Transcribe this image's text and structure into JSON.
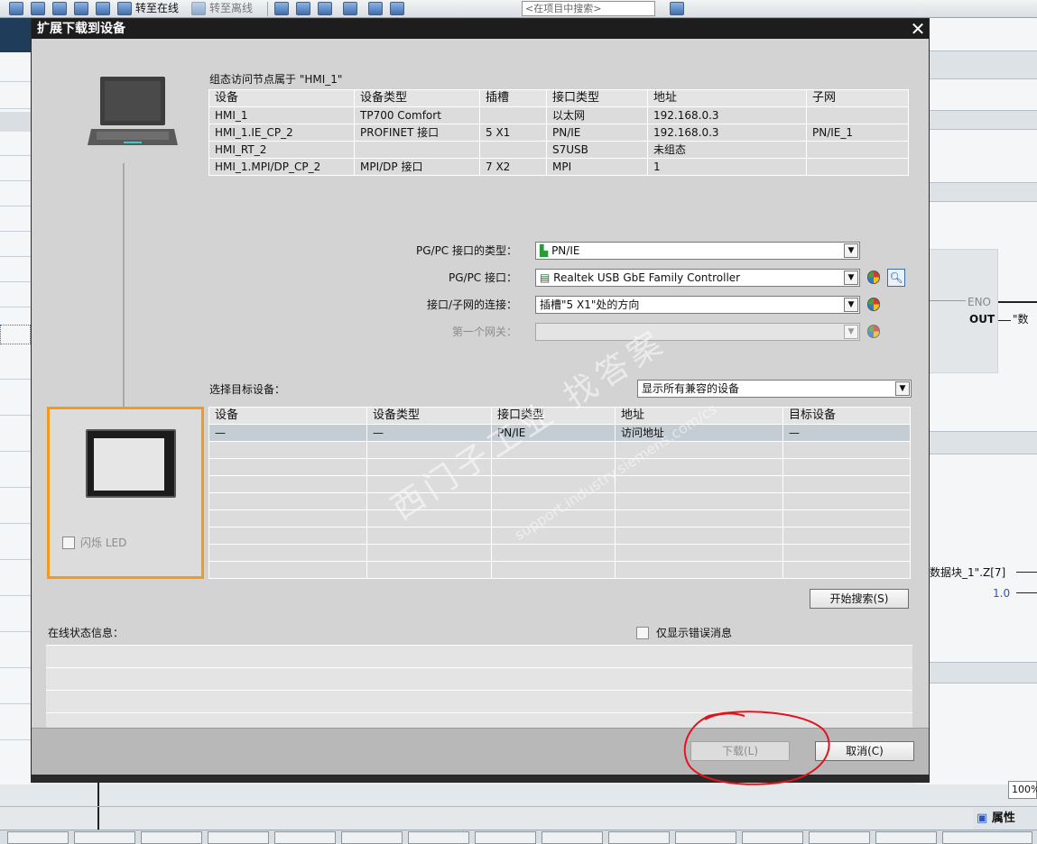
{
  "toolbar": {
    "go_online": "转至在线",
    "go_offline": "转至离线",
    "search_placeholder": "<在项目中搜索>"
  },
  "dialog": {
    "title": "扩展下载到设备",
    "configured_header": "组态访问节点属于 \"HMI_1\"",
    "configured_columns": [
      "设备",
      "设备类型",
      "插槽",
      "接口类型",
      "地址",
      "子网"
    ],
    "configured_rows": [
      [
        "HMI_1",
        "TP700 Comfort",
        "",
        "以太网",
        "192.168.0.3",
        ""
      ],
      [
        "HMI_1.IE_CP_2",
        "PROFINET 接口",
        "5 X1",
        "PN/IE",
        "192.168.0.3",
        "PN/IE_1"
      ],
      [
        "HMI_RT_2",
        "",
        "",
        "S7USB",
        "未组态",
        ""
      ],
      [
        "HMI_1.MPI/DP_CP_2",
        "MPI/DP 接口",
        "7 X2",
        "MPI",
        "1",
        ""
      ]
    ],
    "pgpc_type_label": "PG/PC 接口的类型：",
    "pgpc_type_value": "PN/IE",
    "pgpc_if_label": "PG/PC 接口：",
    "pgpc_if_value": "Realtek USB GbE Family Controller",
    "subnet_conn_label": "接口/子网的连接：",
    "subnet_conn_value": "插槽\"5 X1\"处的方向",
    "gateway_label": "第一个网关：",
    "gateway_value": "",
    "select_target_label": "选择目标设备：",
    "show_filter_value": "显示所有兼容的设备",
    "target_columns": [
      "设备",
      "设备类型",
      "接口类型",
      "地址",
      "目标设备"
    ],
    "target_rows": [
      [
        "—",
        "—",
        "PN/IE",
        "访问地址",
        "—"
      ]
    ],
    "flash_led_label": "闪烁 LED",
    "start_search_label": "开始搜索(S)",
    "online_status_label": "在线状态信息：",
    "only_errors_label": "仅显示错误消息",
    "download_label": "下载(L)",
    "cancel_label": "取消(C)",
    "watermark_text": "西门子工业 找答案",
    "watermark_url": "support.industry.siemens.com/cs"
  },
  "background": {
    "eno_label": "ENO",
    "out_label": "OUT",
    "out_value": "\"数",
    "z_ref": "数据块_1\".Z[7]",
    "const_value": "1.0",
    "zoom": "100%",
    "properties_label": "属性"
  },
  "colors": {
    "title_bar": "#1d1d1d",
    "target_highlight": "#f39a1a",
    "annotation_circle": "#e0141e"
  }
}
